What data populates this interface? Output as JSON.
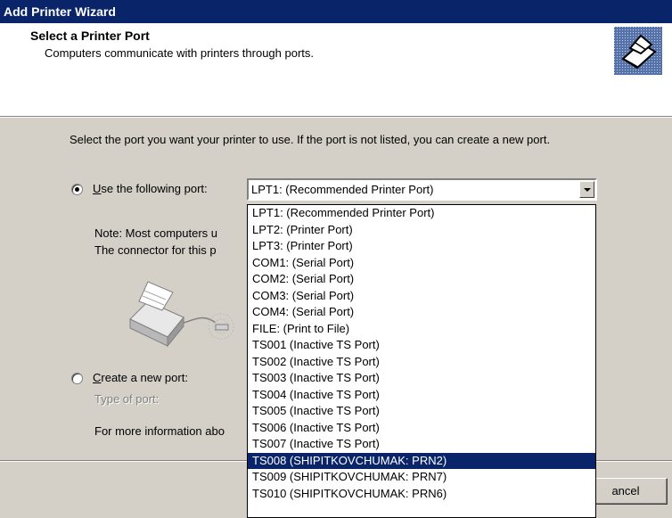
{
  "window": {
    "title": "Add Printer Wizard"
  },
  "header": {
    "title": "Select a Printer Port",
    "subtitle": "Computers communicate with printers through ports."
  },
  "instructions": "Select the port you want your printer to use.  If the port is not listed, you can create a new port.",
  "use_port": {
    "label_prefix": "",
    "label_accel": "U",
    "label_rest": "se the following port:",
    "selected": true,
    "combo_value": "LPT1: (Recommended Printer Port)"
  },
  "note": {
    "line1": "Note: Most computers u",
    "line2": "The connector for this p"
  },
  "create_port": {
    "label_accel": "C",
    "label_rest": "reate a new port:",
    "selected": false,
    "type_label": "Type of port:"
  },
  "more_info": "For more information abo",
  "buttons": {
    "cancel_visible": "ancel"
  },
  "port_list": {
    "selected_index": 15,
    "items": [
      "LPT1: (Recommended Printer Port)",
      "LPT2: (Printer Port)",
      "LPT3: (Printer Port)",
      "COM1: (Serial Port)",
      "COM2: (Serial Port)",
      "COM3: (Serial Port)",
      "COM4: (Serial Port)",
      "FILE: (Print to File)",
      "TS001 (Inactive TS Port)",
      "TS002 (Inactive TS Port)",
      "TS003 (Inactive TS Port)",
      "TS004 (Inactive TS Port)",
      "TS005 (Inactive TS Port)",
      "TS006 (Inactive TS Port)",
      "TS007 (Inactive TS Port)",
      "TS008 (SHIPITKOVCHUMAK:  PRN2)",
      "TS009 (SHIPITKOVCHUMAK:  PRN7)",
      "TS010 (SHIPITKOVCHUMAK:  PRN6)"
    ]
  },
  "colors": {
    "titlebar": "#0a246a",
    "face": "#d4d0c8",
    "selection": "#0a246a"
  }
}
